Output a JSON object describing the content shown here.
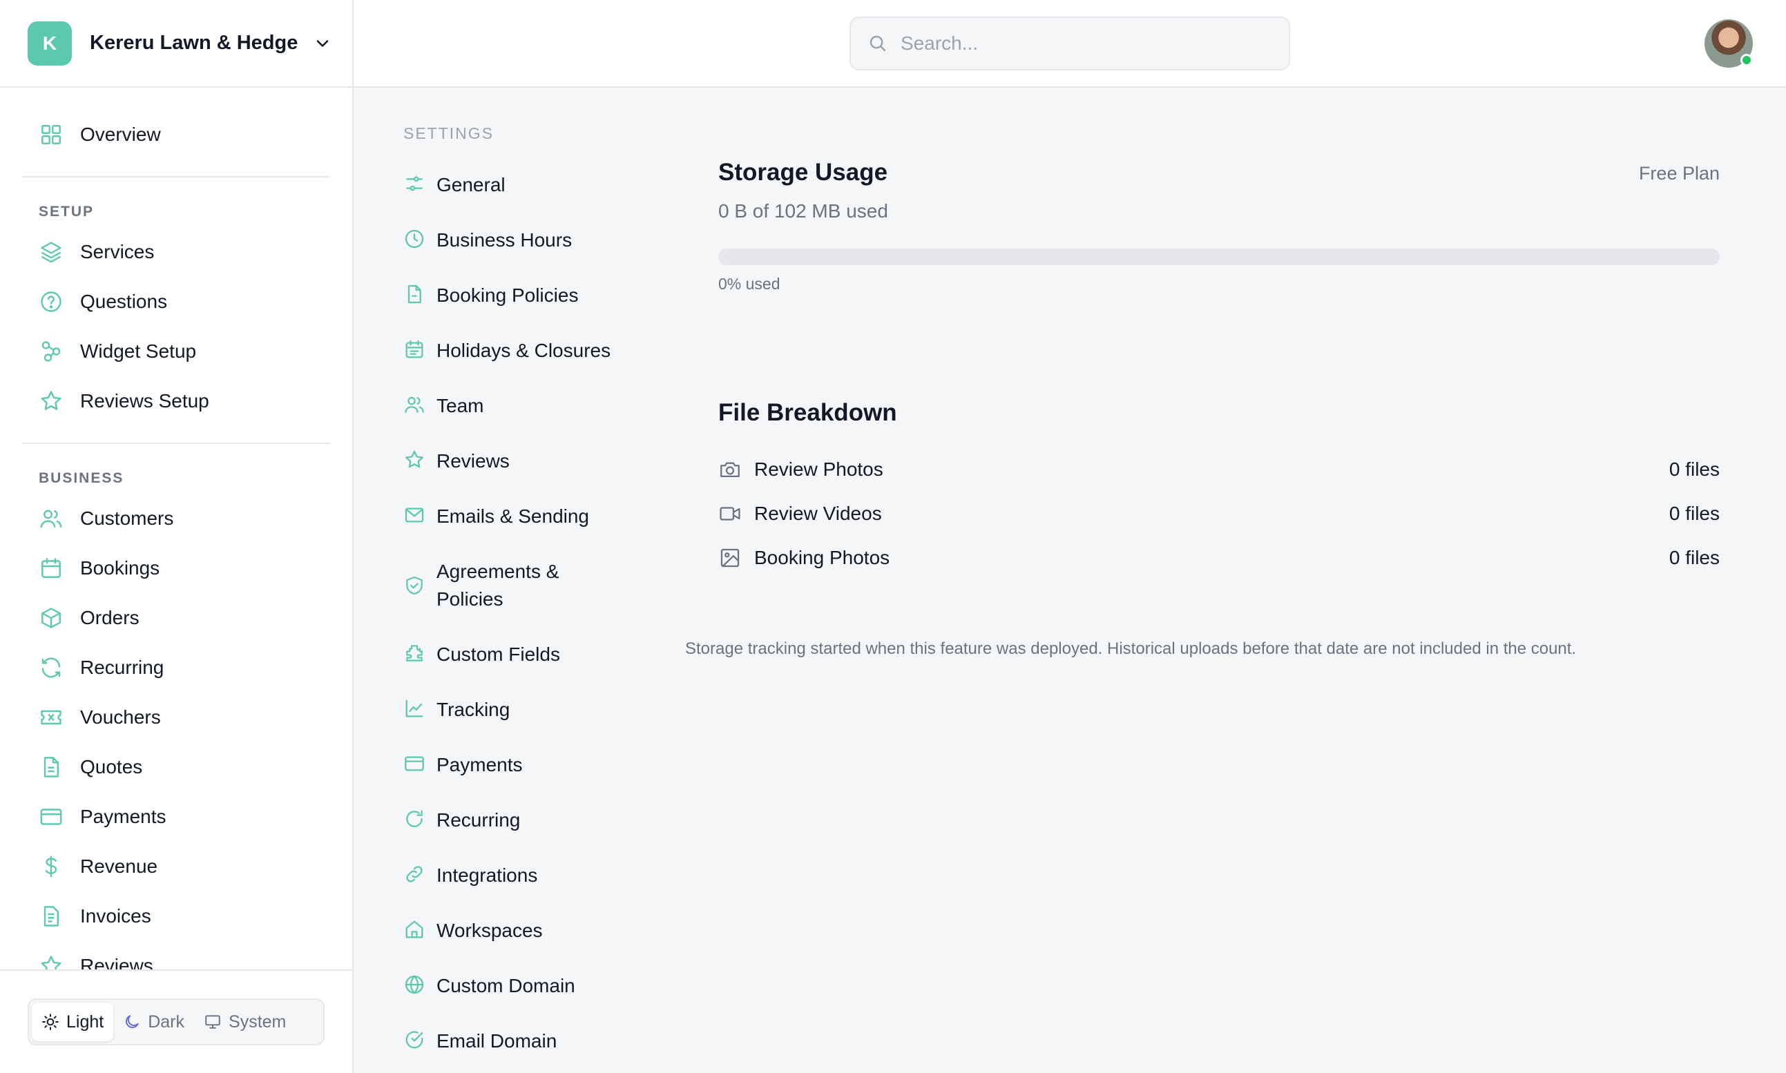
{
  "workspace": {
    "initial": "K",
    "name": "Kereru Lawn & Hedge"
  },
  "search": {
    "placeholder": "Search..."
  },
  "sidebar": {
    "overview": "Overview",
    "setup_title": "SETUP",
    "setup": [
      "Services",
      "Questions",
      "Widget Setup",
      "Reviews Setup"
    ],
    "business_title": "BUSINESS",
    "business": [
      "Customers",
      "Bookings",
      "Orders",
      "Recurring",
      "Vouchers",
      "Quotes",
      "Payments",
      "Revenue",
      "Invoices",
      "Reviews"
    ]
  },
  "theme": {
    "light": "Light",
    "dark": "Dark",
    "system": "System",
    "selected": "Light"
  },
  "settings_nav": {
    "title": "SETTINGS",
    "items": [
      "General",
      "Business Hours",
      "Booking Policies",
      "Holidays & Closures",
      "Team",
      "Reviews",
      "Emails & Sending",
      "Agreements & Policies",
      "Custom Fields",
      "Tracking",
      "Payments",
      "Recurring",
      "Integrations",
      "Workspaces",
      "Custom Domain",
      "Email Domain"
    ]
  },
  "storage": {
    "title": "Storage Usage",
    "plan": "Free Plan",
    "used_text": "0 B of 102 MB used",
    "percent_used": 0,
    "percent_label": "0% used"
  },
  "breakdown": {
    "title": "File Breakdown",
    "rows": [
      {
        "label": "Review Photos",
        "count": "0 files",
        "icon": "camera-icon"
      },
      {
        "label": "Review Videos",
        "count": "0 files",
        "icon": "video-icon"
      },
      {
        "label": "Booking Photos",
        "count": "0 files",
        "icon": "image-icon"
      }
    ]
  },
  "note": "Storage tracking started when this feature was deployed. Historical uploads before that date are not included in the count.",
  "colors": {
    "accent": "#5cc9ae",
    "online": "#22c55e"
  }
}
